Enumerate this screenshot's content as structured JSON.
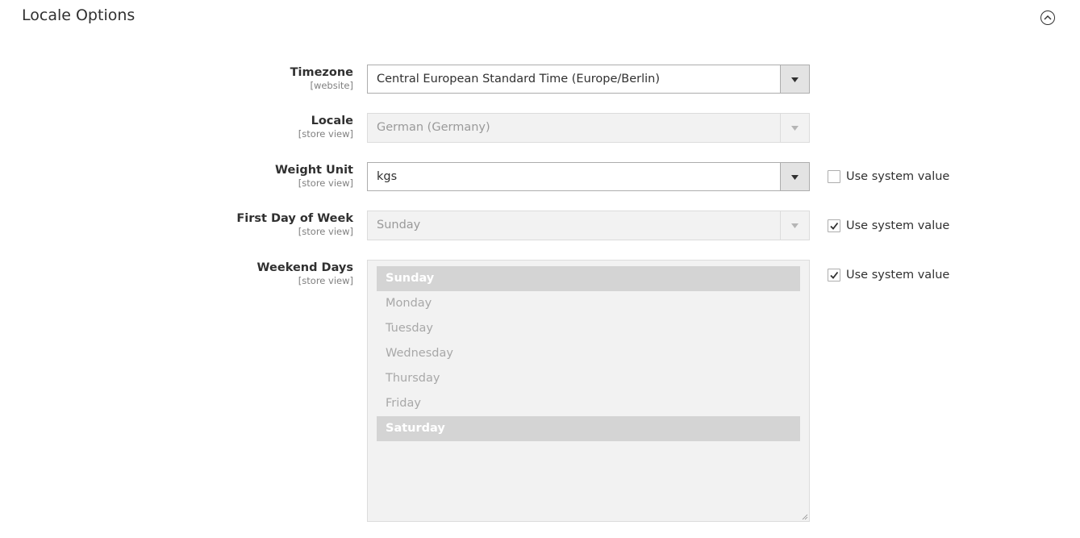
{
  "section": {
    "title": "Locale Options"
  },
  "fields": {
    "timezone": {
      "label": "Timezone",
      "scope": "[website]",
      "value": "Central European Standard Time (Europe/Berlin)"
    },
    "locale": {
      "label": "Locale",
      "scope": "[store view]",
      "value": "German (Germany)"
    },
    "weight_unit": {
      "label": "Weight Unit",
      "scope": "[store view]",
      "value": "kgs",
      "use_system_value_label": "Use system value",
      "use_system_value_checked": false
    },
    "first_day": {
      "label": "First Day of Week",
      "scope": "[store view]",
      "value": "Sunday",
      "use_system_value_label": "Use system value",
      "use_system_value_checked": true
    },
    "weekend_days": {
      "label": "Weekend Days",
      "scope": "[store view]",
      "use_system_value_label": "Use system value",
      "use_system_value_checked": true,
      "options": [
        "Sunday",
        "Monday",
        "Tuesday",
        "Wednesday",
        "Thursday",
        "Friday",
        "Saturday"
      ],
      "selected": [
        "Sunday",
        "Saturday"
      ]
    }
  },
  "icons": {
    "collapse": "chevron-up-circle-icon",
    "dropdown": "triangle-down-icon",
    "check": "checkmark-icon"
  },
  "colors": {
    "text": "#303030",
    "scope_text": "#808080",
    "disabled_bg": "#f2f2f2",
    "selected_option_bg": "#d4d4d4"
  }
}
